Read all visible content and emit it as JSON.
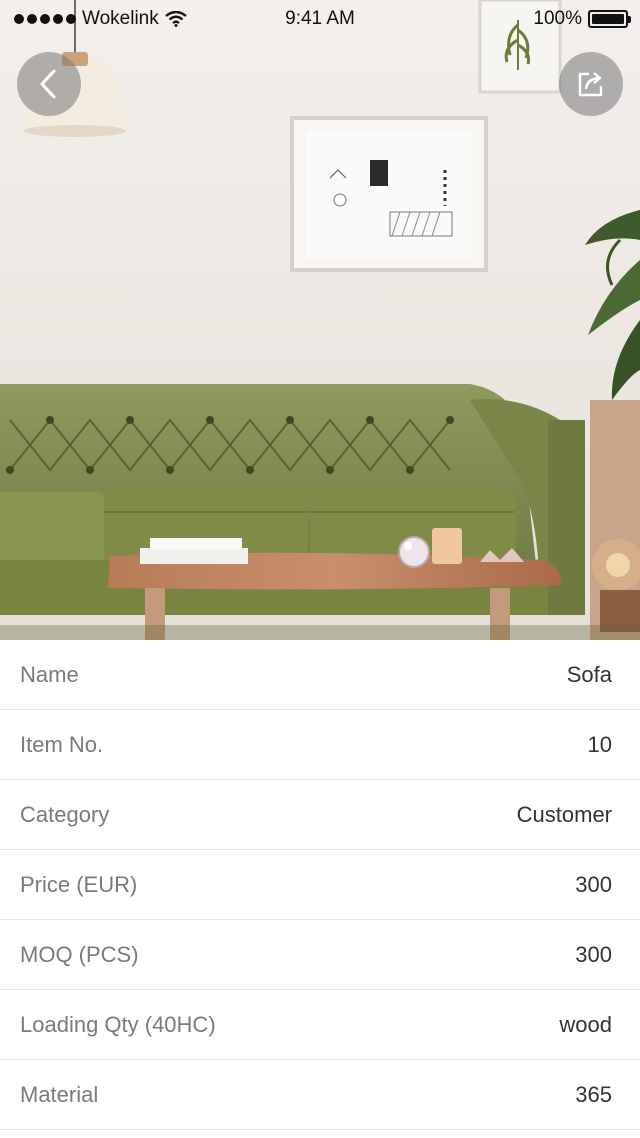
{
  "status_bar": {
    "carrier": "Wokelink",
    "time": "9:41 AM",
    "battery": "100%"
  },
  "icons": {
    "back": "chevron-left-icon",
    "share": "share-icon",
    "wifi": "wifi-icon",
    "battery": "battery-icon"
  },
  "colors": {
    "sofa": "#7d8a4e",
    "wall": "#efe9e4",
    "label": "#7a7a7a",
    "value": "#333333"
  },
  "details": [
    {
      "label": "Name",
      "value": "Sofa"
    },
    {
      "label": "Item No.",
      "value": "10"
    },
    {
      "label": "Category",
      "value": "Customer"
    },
    {
      "label": "Price (EUR)",
      "value": "300"
    },
    {
      "label": "MOQ (PCS)",
      "value": "300"
    },
    {
      "label": "Loading Qty (40HC)",
      "value": "wood"
    },
    {
      "label": "Material",
      "value": "365"
    }
  ]
}
